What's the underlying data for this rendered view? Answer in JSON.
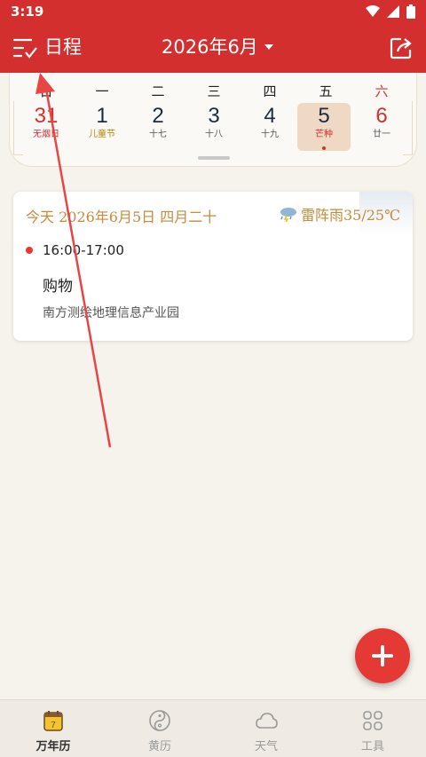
{
  "status_bar": {
    "time": "3:19"
  },
  "app_bar": {
    "title": "日程",
    "month": "2026年6月"
  },
  "week": {
    "weekdays": [
      "日",
      "一",
      "二",
      "三",
      "四",
      "五",
      "六"
    ],
    "days": [
      {
        "num": "31",
        "lunar": "无烟日"
      },
      {
        "num": "1",
        "lunar": "儿童节"
      },
      {
        "num": "2",
        "lunar": "十七"
      },
      {
        "num": "3",
        "lunar": "十八"
      },
      {
        "num": "4",
        "lunar": "十九"
      },
      {
        "num": "5",
        "lunar": "芒种"
      },
      {
        "num": "6",
        "lunar": "廿一"
      }
    ]
  },
  "event_card": {
    "date_line": "今天 2026年6月5日 四月二十",
    "weather": "雷阵雨35/25℃",
    "event": {
      "time": "16:00-17:00",
      "title": "购物",
      "location": "南方测绘地理信息产业园"
    }
  },
  "bottom_nav": [
    {
      "label": "万年历",
      "icon": "calendar-icon",
      "active": true
    },
    {
      "label": "黄历",
      "icon": "yin-yang-icon",
      "active": false
    },
    {
      "label": "天气",
      "icon": "cloud-icon",
      "active": false
    },
    {
      "label": "工具",
      "icon": "tools-icon",
      "active": false
    }
  ],
  "colors": {
    "primary": "#d32f2f",
    "accent_gold": "#c58a3a",
    "fab": "#e53935"
  }
}
